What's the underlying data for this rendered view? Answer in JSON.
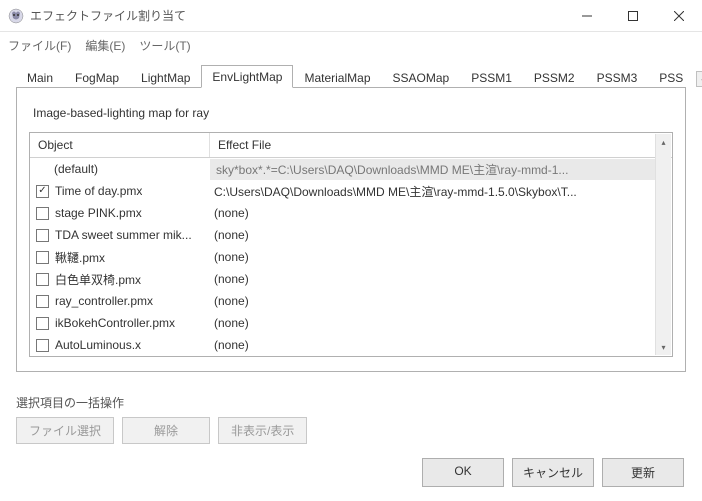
{
  "window": {
    "title": "エフェクトファイル割り当て",
    "minimize": "—",
    "maximize": "▢",
    "close": "✕"
  },
  "menu": {
    "file": "ファイル(F)",
    "edit": "編集(E)",
    "tool": "ツール(T)"
  },
  "tabs": {
    "items": [
      {
        "label": "Main"
      },
      {
        "label": "FogMap"
      },
      {
        "label": "LightMap"
      },
      {
        "label": "EnvLightMap"
      },
      {
        "label": "MaterialMap"
      },
      {
        "label": "SSAOMap"
      },
      {
        "label": "PSSM1"
      },
      {
        "label": "PSSM2"
      },
      {
        "label": "PSSM3"
      },
      {
        "label": "PSS"
      }
    ],
    "active_index": 3,
    "scroll_left": "◀",
    "scroll_right": "▶"
  },
  "panel": {
    "description": "Image-based-lighting map for ray"
  },
  "grid": {
    "col_object": "Object",
    "col_effect": "Effect File",
    "default_label": "(default)",
    "default_value": "sky*box*.*=C:\\Users\\DAQ\\Downloads\\MMD ME\\主渲\\ray-mmd-1...",
    "rows": [
      {
        "checked": true,
        "name": "Time of day.pmx",
        "effect": "C:\\Users\\DAQ\\Downloads\\MMD ME\\主渲\\ray-mmd-1.5.0\\Skybox\\T..."
      },
      {
        "checked": false,
        "name": "stage PINK.pmx",
        "effect": "(none)"
      },
      {
        "checked": false,
        "name": "TDA sweet summer mik...",
        "effect": "(none)"
      },
      {
        "checked": false,
        "name": "鞦韆.pmx",
        "effect": "(none)"
      },
      {
        "checked": false,
        "name": "白色单双椅.pmx",
        "effect": "(none)"
      },
      {
        "checked": false,
        "name": "ray_controller.pmx",
        "effect": "(none)"
      },
      {
        "checked": false,
        "name": "ikBokehController.pmx",
        "effect": "(none)"
      },
      {
        "checked": false,
        "name": "AutoLuminous.x",
        "effect": "(none)"
      }
    ]
  },
  "batch": {
    "label": "選択項目の一括操作",
    "file_select": "ファイル選択",
    "clear": "解除",
    "toggle": "非表示/表示"
  },
  "footer": {
    "ok": "OK",
    "cancel": "キャンセル",
    "update": "更新"
  }
}
